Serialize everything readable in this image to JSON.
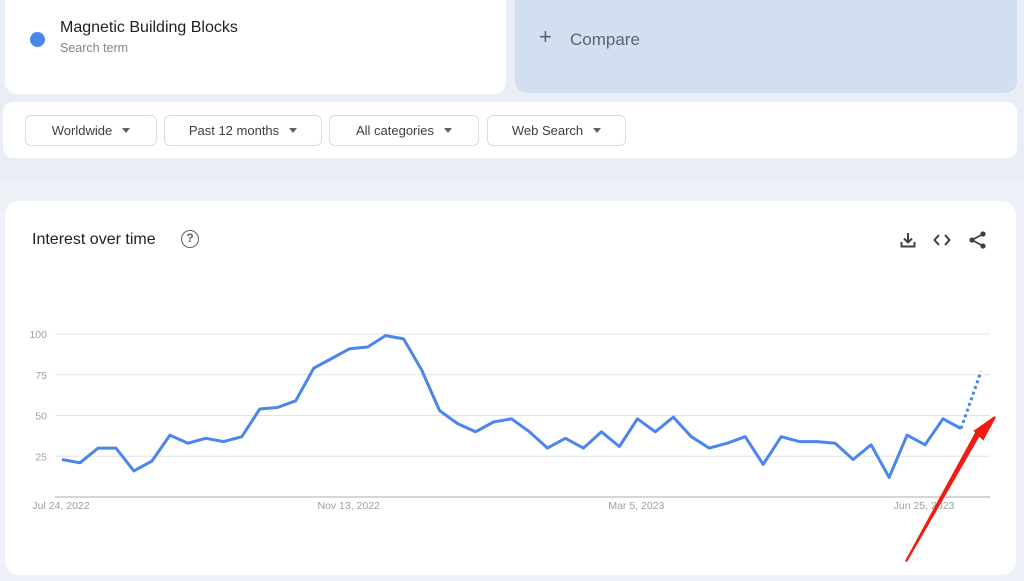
{
  "search_term": {
    "name": "Magnetic Building Blocks",
    "type_label": "Search term",
    "color": "#4a86ec"
  },
  "compare": {
    "label": "Compare",
    "icon": "plus-icon"
  },
  "filters": [
    {
      "label": "Worldwide"
    },
    {
      "label": "Past 12 months"
    },
    {
      "label": "All categories"
    },
    {
      "label": "Web Search"
    }
  ],
  "panel": {
    "title": "Interest over time",
    "help_icon": "?",
    "actions": [
      "download-icon",
      "embed-icon",
      "share-icon"
    ]
  },
  "chart_data": {
    "type": "line",
    "title": "Interest over time",
    "xlabel": "",
    "ylabel": "",
    "ylim": [
      0,
      100
    ],
    "yticks": [
      25,
      50,
      75,
      100
    ],
    "xtick_labels": [
      {
        "label": "Jul 24, 2022",
        "index": 0
      },
      {
        "label": "Nov 13, 2022",
        "index": 16
      },
      {
        "label": "Mar 5, 2023",
        "index": 32
      },
      {
        "label": "Jun 25, 2023",
        "index": 48
      }
    ],
    "grid": true,
    "series": [
      {
        "name": "Magnetic Building Blocks",
        "color": "#4a86ec",
        "values": [
          23,
          21,
          30,
          30,
          16,
          22,
          38,
          33,
          36,
          34,
          37,
          54,
          55,
          59,
          79,
          85,
          91,
          92,
          99,
          97,
          78,
          53,
          45,
          40,
          46,
          48,
          40,
          30,
          36,
          30,
          40,
          31,
          48,
          40,
          49,
          37,
          30,
          33,
          37,
          20,
          37,
          34,
          34,
          33,
          23,
          32,
          12,
          38,
          32,
          48,
          42
        ],
        "partial_value": 77
      }
    ],
    "annotation": {
      "type": "arrow",
      "color": "#f01c10",
      "points_to": "partial data point"
    }
  }
}
